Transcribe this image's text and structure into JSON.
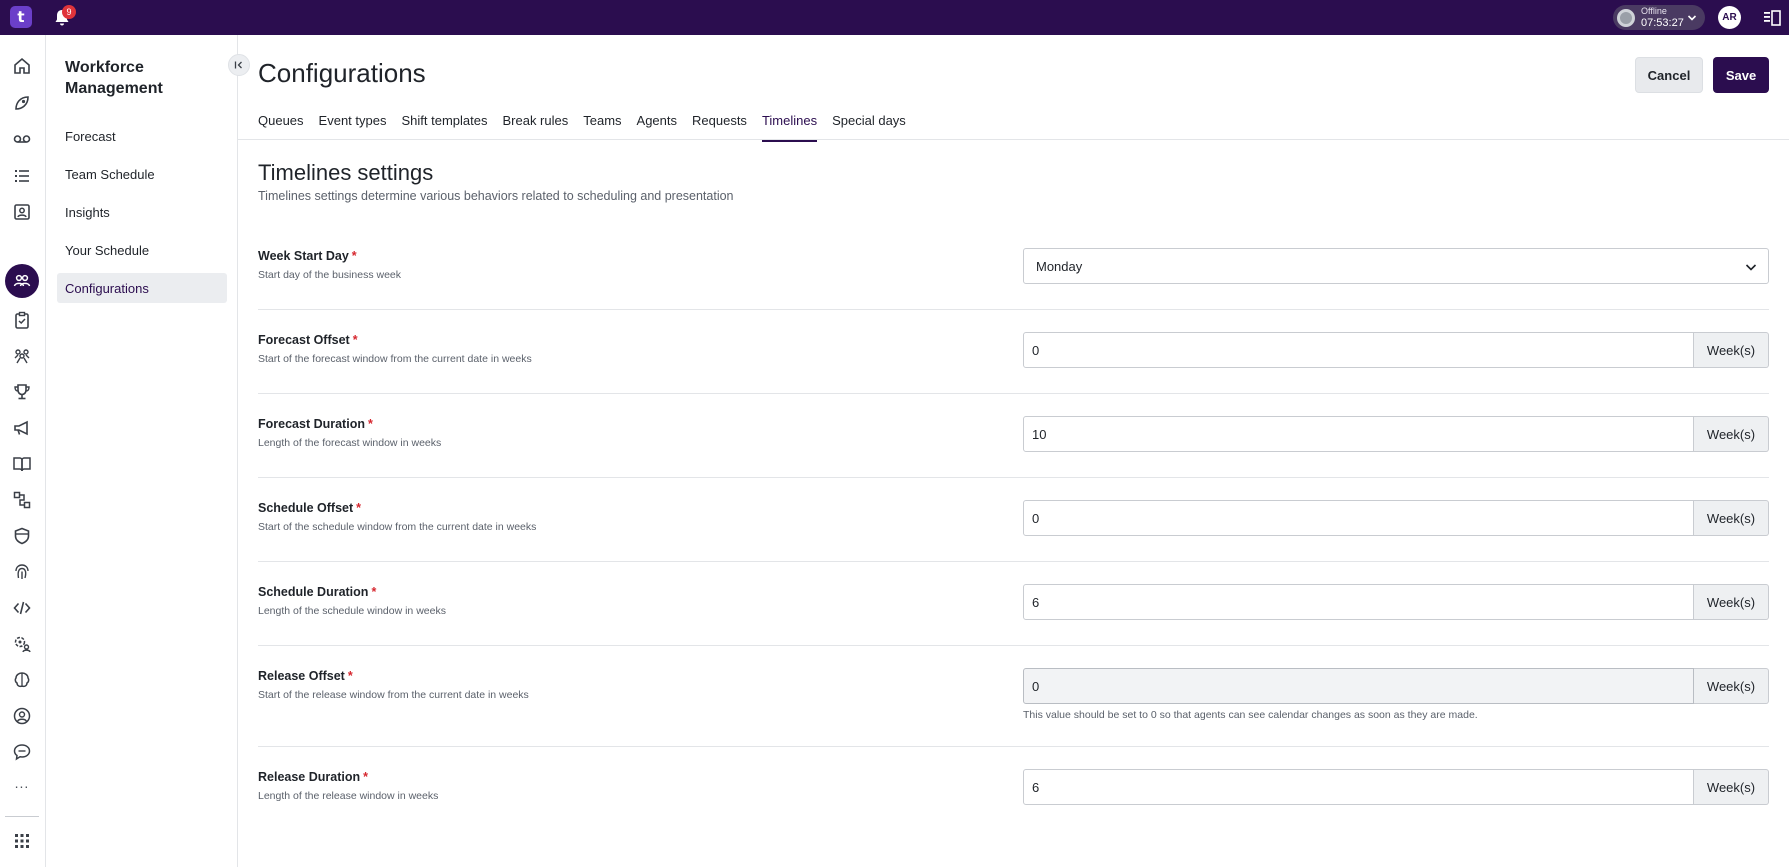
{
  "topbar": {
    "logo_text": "t",
    "notification_count": "9",
    "status": {
      "label": "Offline",
      "timer": "07:53:27"
    },
    "avatar_initials": "AR"
  },
  "rail": {
    "icons": [
      "home-icon",
      "rocket-icon",
      "voicemail-icon",
      "list-icon",
      "contact-card-icon",
      "workforce-icon",
      "clipboard-icon",
      "team-icon",
      "trophy-icon",
      "megaphone-icon",
      "book-icon",
      "flow-icon",
      "shield-icon",
      "fingerprint-icon",
      "code-icon",
      "settings-people-icon",
      "brain-icon",
      "user-circle-icon",
      "chat-icon"
    ],
    "more": "...",
    "apps_icon": "grid-icon"
  },
  "nav": {
    "title": "Workforce Management",
    "items": [
      {
        "label": "Forecast"
      },
      {
        "label": "Team Schedule"
      },
      {
        "label": "Insights"
      },
      {
        "label": "Your Schedule"
      },
      {
        "label": "Configurations"
      }
    ]
  },
  "header": {
    "title": "Configurations",
    "cancel_label": "Cancel",
    "save_label": "Save"
  },
  "tabs": [
    {
      "label": "Queues"
    },
    {
      "label": "Event types"
    },
    {
      "label": "Shift templates"
    },
    {
      "label": "Break rules"
    },
    {
      "label": "Teams"
    },
    {
      "label": "Agents"
    },
    {
      "label": "Requests"
    },
    {
      "label": "Timelines"
    },
    {
      "label": "Special days"
    }
  ],
  "section": {
    "title": "Timelines settings",
    "description": "Timelines settings determine various behaviors related to scheduling and presentation"
  },
  "fields": {
    "week_start_day": {
      "label": "Week Start Day",
      "required": "*",
      "help": "Start day of the business week",
      "value": "Monday"
    },
    "forecast_offset": {
      "label": "Forecast Offset",
      "required": "*",
      "help": "Start of the forecast window from the current date in weeks",
      "value": "0",
      "unit": "Week(s)"
    },
    "forecast_duration": {
      "label": "Forecast Duration",
      "required": "*",
      "help": "Length of the forecast window in weeks",
      "value": "10",
      "unit": "Week(s)"
    },
    "schedule_offset": {
      "label": "Schedule Offset",
      "required": "*",
      "help": "Start of the schedule window from the current date in weeks",
      "value": "0",
      "unit": "Week(s)"
    },
    "schedule_duration": {
      "label": "Schedule Duration",
      "required": "*",
      "help": "Length of the schedule window in weeks",
      "value": "6",
      "unit": "Week(s)"
    },
    "release_offset": {
      "label": "Release Offset",
      "required": "*",
      "help": "Start of the release window from the current date in weeks",
      "value": "0",
      "unit": "Week(s)",
      "note": "This value should be set to 0 so that agents can see calendar changes as soon as they are made."
    },
    "release_duration": {
      "label": "Release Duration",
      "required": "*",
      "help": "Length of the release window in weeks",
      "value": "6",
      "unit": "Week(s)"
    }
  },
  "colors": {
    "brand": "#2b0d4f",
    "required": "#d6262e",
    "badge": "#e0343b"
  }
}
